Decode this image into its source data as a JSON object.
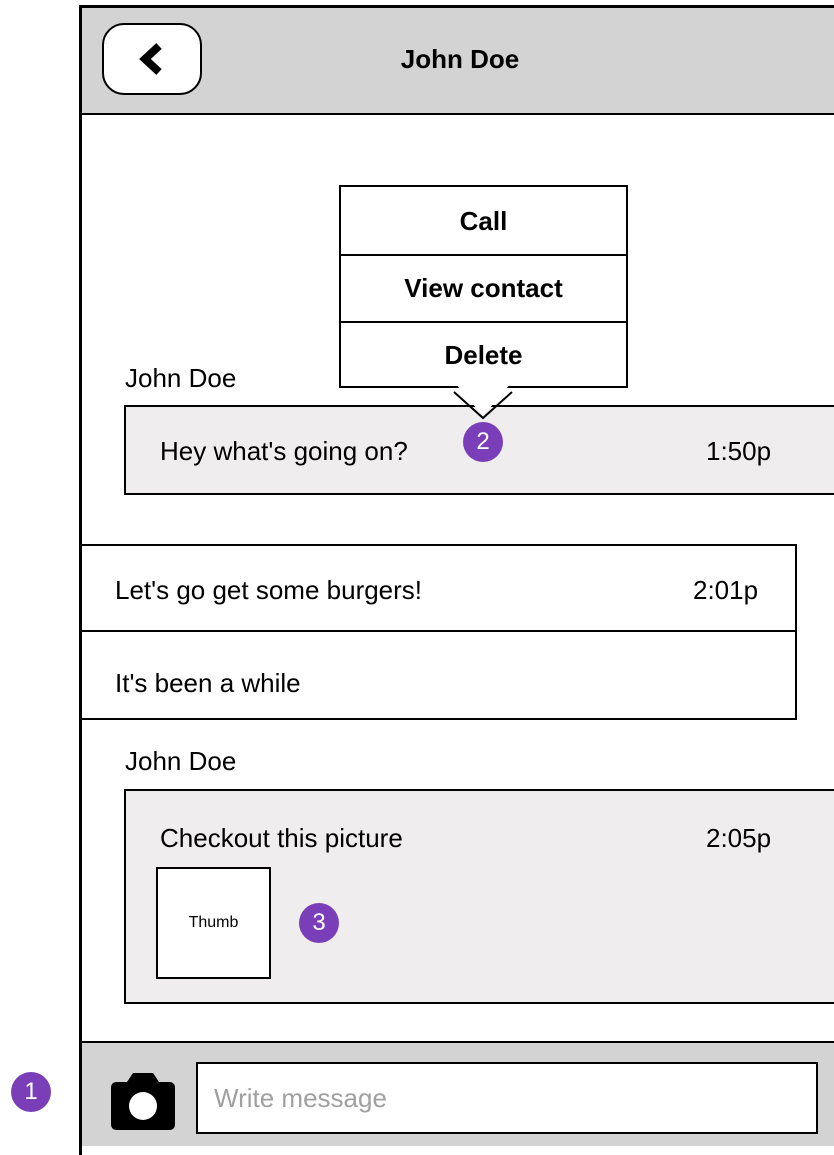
{
  "header": {
    "title": "John Doe",
    "back_icon": "chevron-left-icon"
  },
  "context_menu": {
    "items": [
      "Call",
      "View contact",
      "Delete"
    ]
  },
  "messages": [
    {
      "sender": "John Doe",
      "text": "Hey what's going on?",
      "time": "1:50p"
    },
    {
      "sender": "",
      "text": "Let's go get some burgers!",
      "time": "2:01p",
      "extra": "It's been a while"
    },
    {
      "sender": "John Doe",
      "text": "Checkout this picture",
      "time": "2:05p",
      "thumb_label": "Thumb"
    }
  ],
  "annotations": [
    "1",
    "2",
    "3"
  ],
  "composer": {
    "placeholder": "Write message",
    "camera_icon": "camera-icon"
  },
  "colors": {
    "header_bg": "#d3d3d3",
    "incoming_bg": "#efedee",
    "badge": "#7a3fb8"
  }
}
